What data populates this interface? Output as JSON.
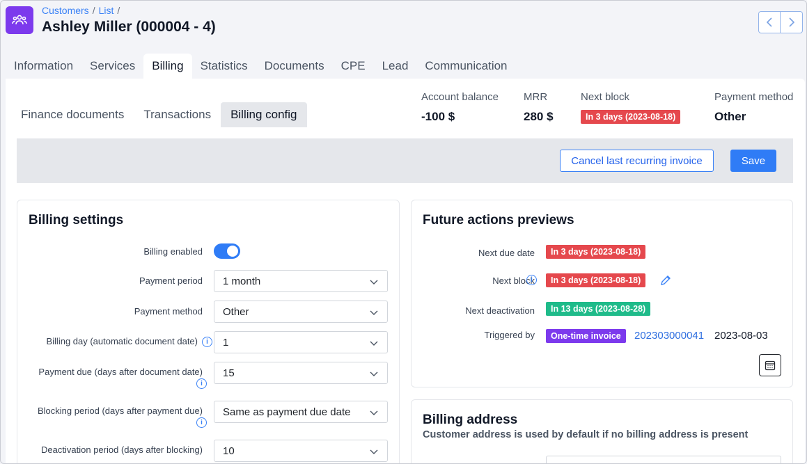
{
  "breadcrumbs": [
    "Customers",
    "List"
  ],
  "page_title": "Ashley Miller (000004 - 4)",
  "icons": {
    "app": "customers-icon",
    "prev": "chevron-left-icon",
    "next": "chevron-right-icon"
  },
  "tabs": [
    "Information",
    "Services",
    "Billing",
    "Statistics",
    "Documents",
    "CPE",
    "Lead",
    "Communication"
  ],
  "active_tab": "Billing",
  "subtabs": [
    "Finance documents",
    "Transactions",
    "Billing config"
  ],
  "active_subtab": "Billing config",
  "summary": {
    "account_balance_label": "Account balance",
    "account_balance_value": "-100 $",
    "mrr_label": "MRR",
    "mrr_value": "280 $",
    "next_block_label": "Next block",
    "next_block_value": "In 3 days (2023-08-18)",
    "payment_method_label": "Payment method",
    "payment_method_value": "Other"
  },
  "actions": {
    "cancel_label": "Cancel last recurring invoice",
    "save_label": "Save"
  },
  "billing_settings": {
    "title": "Billing settings",
    "billing_enabled_label": "Billing enabled",
    "billing_enabled": true,
    "payment_period_label": "Payment period",
    "payment_period_value": "1 month",
    "payment_method_label": "Payment method",
    "payment_method_value": "Other",
    "billing_day_label": "Billing day (automatic document date)",
    "billing_day_value": "1",
    "payment_due_label": "Payment due (days after document date)",
    "payment_due_value": "15",
    "blocking_period_label": "Blocking period (days after payment due)",
    "blocking_period_value": "Same as payment due date",
    "deactivation_period_label": "Deactivation period (days after blocking)",
    "deactivation_period_value": "10"
  },
  "future_actions": {
    "title": "Future actions previews",
    "next_due_date_label": "Next due date",
    "next_due_date_value": "In 3 days (2023-08-18)",
    "next_block_label": "Next block",
    "next_block_value": "In 3 days (2023-08-18)",
    "next_deactivation_label": "Next deactivation",
    "next_deactivation_value": "In 13 days (2023-08-28)",
    "triggered_by_label": "Triggered by",
    "triggered_by_badge": "One-time invoice",
    "triggered_by_number": "202303000041",
    "triggered_by_date": "2023-08-03"
  },
  "billing_address": {
    "title": "Billing address",
    "subtitle": "Customer address is used by default if no billing address is present"
  },
  "colors": {
    "accent": "#2f7cf6",
    "danger": "#e5484d",
    "success": "#1fbb8a",
    "brand": "#7c3aed"
  }
}
